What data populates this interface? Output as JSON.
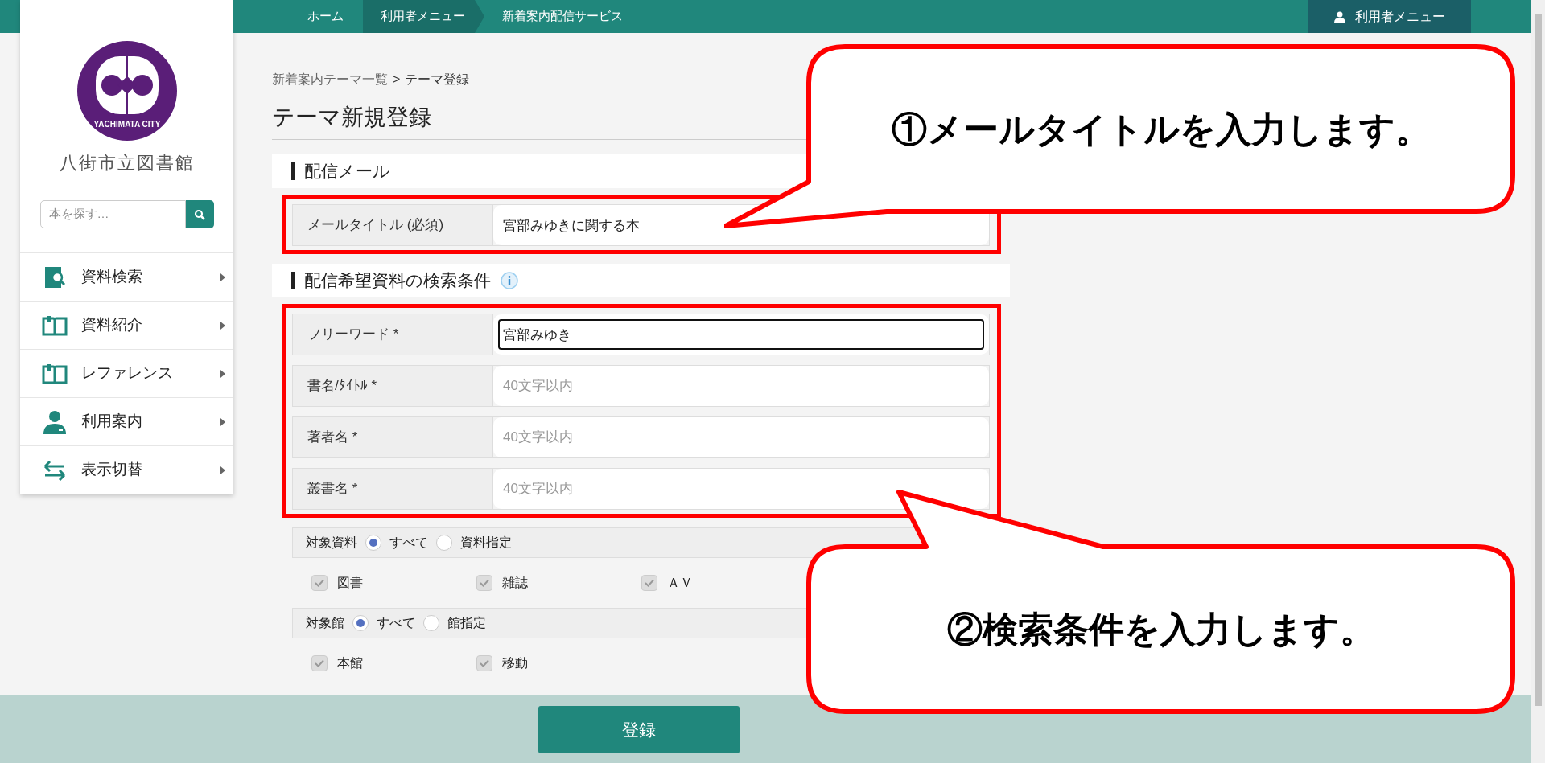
{
  "top_nav": {
    "breadcrumbs": [
      {
        "label": "ホーム",
        "selected": false
      },
      {
        "label": "利用者メニュー",
        "selected": true
      },
      {
        "label": "新着案内配信サービス",
        "selected": false
      }
    ],
    "user_menu": "利用者メニュー"
  },
  "sidebar": {
    "logo_text": "YACHIMATA CITY",
    "library_name": "八街市立図書館",
    "search": {
      "placeholder": "本を探す…"
    },
    "items": [
      {
        "label": "資料検索",
        "kind": "search"
      },
      {
        "label": "資料紹介",
        "kind": "book"
      },
      {
        "label": "レファレンス",
        "kind": "book"
      },
      {
        "label": "利用案内",
        "kind": "person"
      },
      {
        "label": "表示切替",
        "kind": "switch"
      }
    ]
  },
  "breadcrumb": {
    "parent": "新着案内テーマ一覧",
    "separator": ">",
    "current": "テーマ登録"
  },
  "page_title": "テーマ新規登録",
  "sections": [
    {
      "title": "配信メール",
      "info": false,
      "highlighted": true,
      "fields": [
        {
          "label": "メールタイトル (必須)",
          "value": "宮部みゆきに関する本",
          "focused": false
        }
      ]
    },
    {
      "title": "配信希望資料の検索条件",
      "info": true,
      "highlighted": true,
      "fields": [
        {
          "label": "フリーワード *",
          "value": "宮部みゆき",
          "focused": true
        },
        {
          "label": "書名/ﾀｲﾄﾙ *",
          "placeholder": "40文字以内",
          "focused": false
        },
        {
          "label": "著者名 *",
          "placeholder": "40文字以内",
          "focused": false
        },
        {
          "label": "叢書名 *",
          "placeholder": "40文字以内",
          "focused": false
        }
      ]
    }
  ],
  "filters": [
    {
      "label": "対象資料",
      "options": [
        {
          "label": "すべて",
          "selected": true
        },
        {
          "label": "資料指定",
          "selected": false
        }
      ],
      "checkboxes": [
        {
          "label": "図書",
          "checked": true,
          "disabled": true
        },
        {
          "label": "雑誌",
          "checked": true,
          "disabled": true
        },
        {
          "label": "ＡＶ",
          "checked": true,
          "disabled": true
        }
      ]
    },
    {
      "label": "対象館",
      "options": [
        {
          "label": "すべて",
          "selected": true
        },
        {
          "label": "館指定",
          "selected": false
        }
      ],
      "checkboxes": [
        {
          "label": "本館",
          "checked": true,
          "disabled": true
        },
        {
          "label": "移動",
          "checked": true,
          "disabled": true
        }
      ]
    }
  ],
  "submit_button": "登録",
  "callouts": [
    {
      "text": "①メールタイトルを入力します。"
    },
    {
      "text": "②検索条件を入力します。"
    }
  ]
}
